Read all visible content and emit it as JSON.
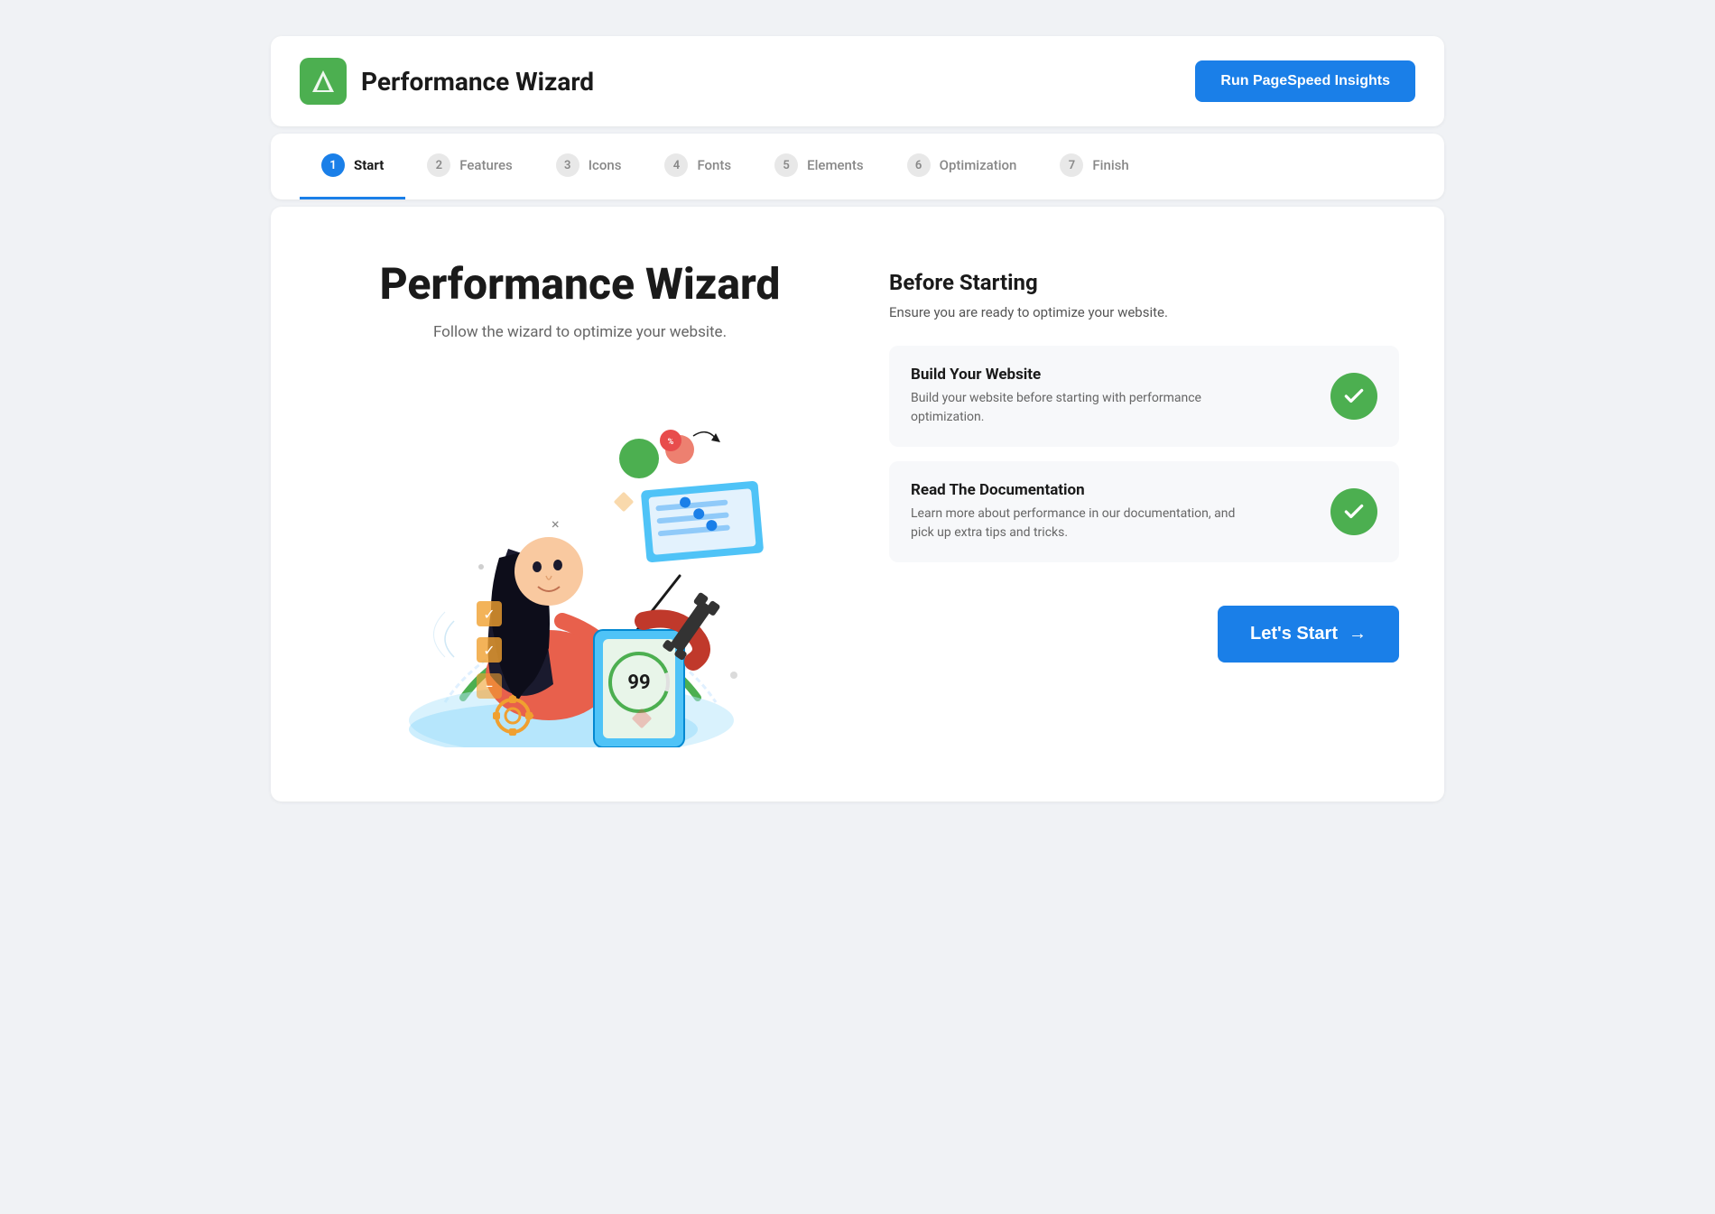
{
  "header": {
    "title": "Performance Wizard",
    "run_btn_label": "Run PageSpeed Insights"
  },
  "steps": [
    {
      "num": "1",
      "label": "Start",
      "active": true
    },
    {
      "num": "2",
      "label": "Features",
      "active": false
    },
    {
      "num": "3",
      "label": "Icons",
      "active": false
    },
    {
      "num": "4",
      "label": "Fonts",
      "active": false
    },
    {
      "num": "5",
      "label": "Elements",
      "active": false
    },
    {
      "num": "6",
      "label": "Optimization",
      "active": false
    },
    {
      "num": "7",
      "label": "Finish",
      "active": false
    }
  ],
  "main": {
    "title": "Performance Wizard",
    "subtitle": "Follow the wizard to optimize your website.",
    "before_title": "Before Starting",
    "before_desc": "Ensure you are ready to optimize your website.",
    "checklist": [
      {
        "title": "Build Your Website",
        "desc": "Build your website before starting with performance optimization."
      },
      {
        "title": "Read The Documentation",
        "desc": "Learn more about performance in our documentation, and pick up extra tips and tricks."
      }
    ],
    "start_btn_label": "Let's Start",
    "start_btn_arrow": "→"
  },
  "logo": {
    "alt": "Performance Wizard Logo"
  }
}
